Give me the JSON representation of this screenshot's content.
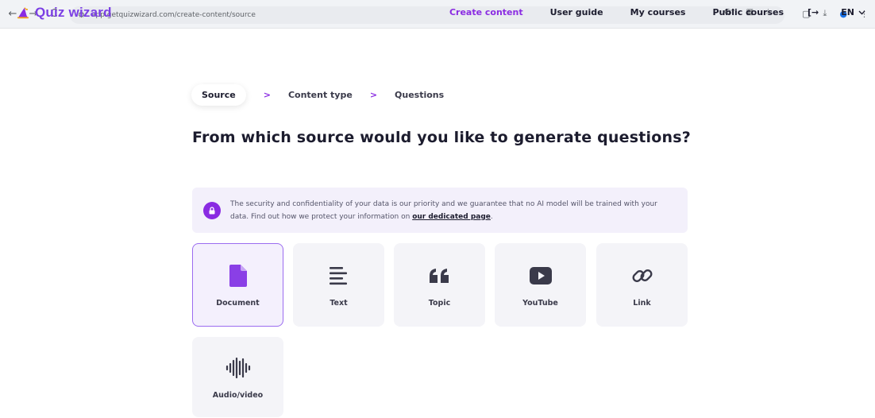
{
  "browser": {
    "url": "app.getquizwizard.com/create-content/source"
  },
  "app": {
    "logo_text": "Quiz wizard",
    "brand_color": "#8a2be2"
  },
  "nav": {
    "items": [
      {
        "label": "Create content",
        "active": true
      },
      {
        "label": "User guide"
      },
      {
        "label": "My courses"
      },
      {
        "label": "Public courses"
      }
    ],
    "language": "EN"
  },
  "stepper": {
    "steps": [
      "Source",
      "Content type",
      "Questions"
    ],
    "separator": ">"
  },
  "page": {
    "title": "From which source would you like to generate questions?"
  },
  "banner": {
    "text": "The security and confidentiality of your data is our priority and we guarantee that no AI model will be trained with your data. Find out how we protect your information on ",
    "link_text": "our dedicated page",
    "suffix": "."
  },
  "sources": [
    {
      "label": "Document",
      "icon": "document-icon",
      "selected": true
    },
    {
      "label": "Text",
      "icon": "text-lines-icon"
    },
    {
      "label": "Topic",
      "icon": "quote-icon"
    },
    {
      "label": "YouTube",
      "icon": "youtube-icon"
    },
    {
      "label": "Link",
      "icon": "link-icon"
    },
    {
      "label": "Audio/video",
      "icon": "audio-wave-icon"
    }
  ]
}
